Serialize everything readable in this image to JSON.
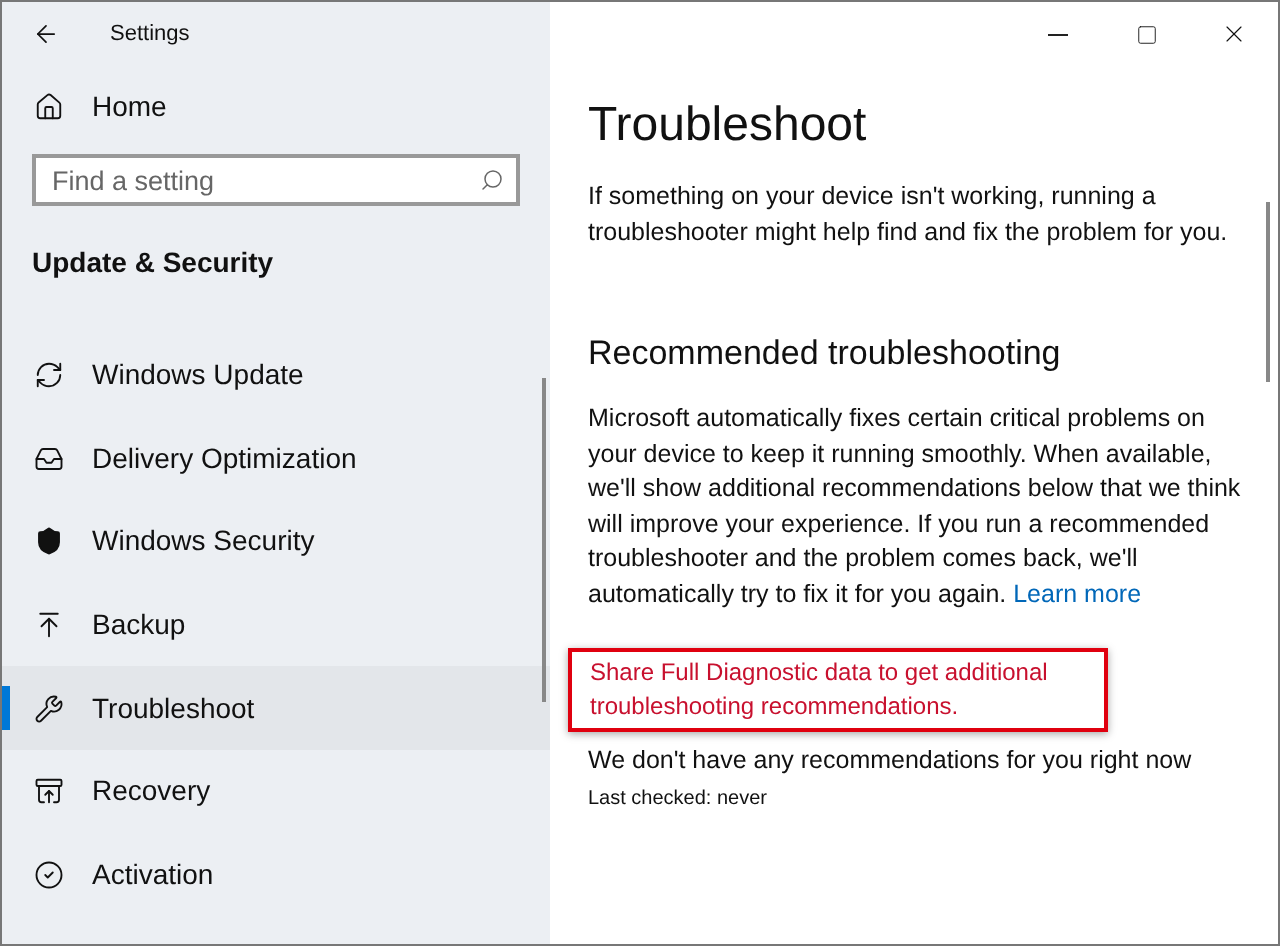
{
  "window": {
    "title": "Settings"
  },
  "sidebar": {
    "home": "Home",
    "search": {
      "placeholder": "Find a setting"
    },
    "section": "Update & Security",
    "items": [
      {
        "label": "Windows Update",
        "selected": false
      },
      {
        "label": "Delivery Optimization",
        "selected": false
      },
      {
        "label": "Windows Security",
        "selected": false
      },
      {
        "label": "Backup",
        "selected": false
      },
      {
        "label": "Troubleshoot",
        "selected": true
      },
      {
        "label": "Recovery",
        "selected": false
      },
      {
        "label": "Activation",
        "selected": false
      }
    ]
  },
  "main": {
    "title": "Troubleshoot",
    "intro": "If something on your device isn't working, running a troubleshooter might help find and fix the problem for you.",
    "heading": "Recommended troubleshooting",
    "description": "Microsoft automatically fixes certain critical problems on your device to keep it running smoothly. When available, we'll show additional recommendations below that we think will improve your experience. If you run a recommended troubleshooter and the problem comes back, we'll automatically try to fix it for you again.",
    "learn_more": "Learn more",
    "diagnostic_link": {
      "text": "Share Full Diagnostic data to get additional troubleshooting recommendations.",
      "highlighted": true
    },
    "status": "We don't have any recommendations for you right now",
    "last_checked": "Last checked: never"
  }
}
